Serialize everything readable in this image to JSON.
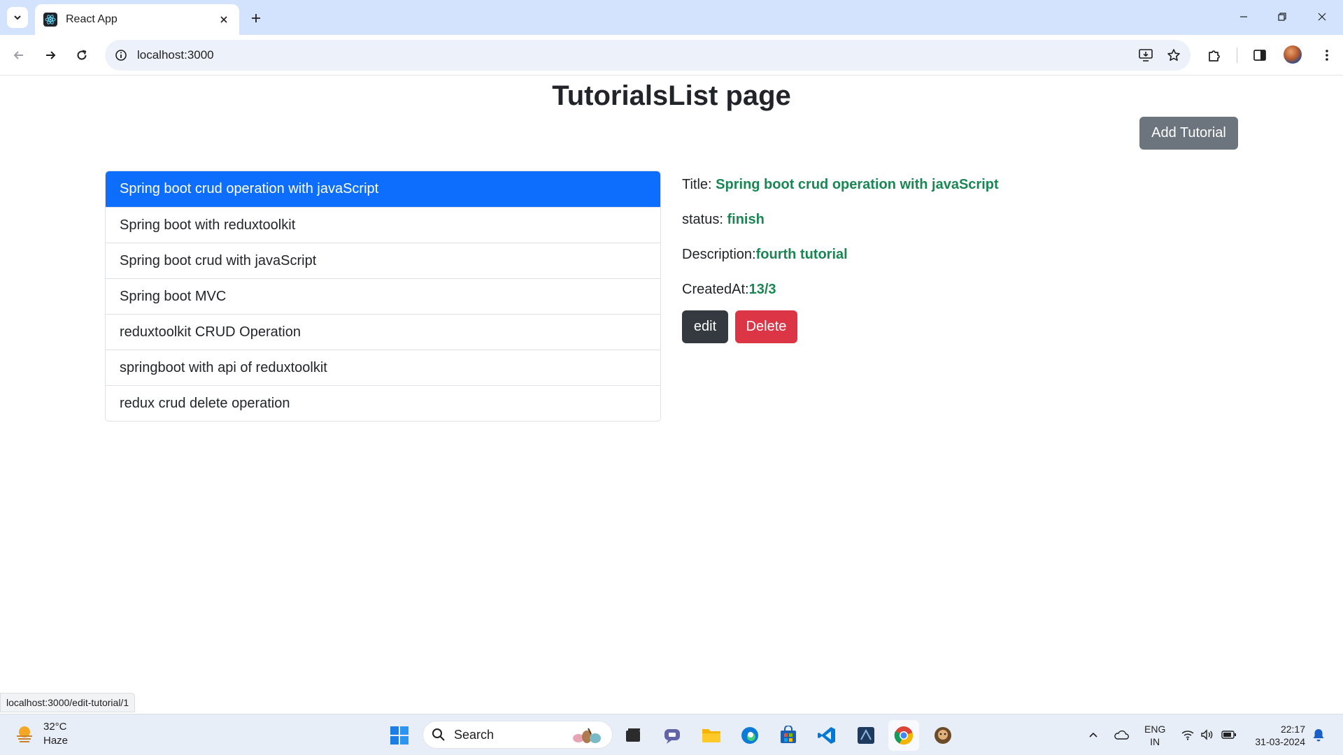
{
  "browser": {
    "tab_title": "React App",
    "url": "localhost:3000"
  },
  "page": {
    "title": "TutorialsList page",
    "add_button": "Add Tutorial",
    "tutorials": [
      "Spring boot crud operation with javaScript",
      "Spring boot with reduxtoolkit",
      "Spring boot crud with javaScript",
      "Spring boot MVC",
      "reduxtoolkit CRUD Operation",
      "springboot with api of reduxtoolkit",
      "redux crud delete operation"
    ],
    "selected_index": 0,
    "details": {
      "title_label": "Title:",
      "title_value": "Spring boot crud operation with javaScript",
      "status_label": "status:",
      "status_value": "finish",
      "description_label": "Description:",
      "description_value": "fourth tutorial",
      "created_label": "CreatedAt:",
      "created_value": "13/3"
    },
    "edit_button": "edit",
    "delete_button": "Delete"
  },
  "status_bar_link": "localhost:3000/edit-tutorial/1",
  "taskbar": {
    "temperature": "32°C",
    "weather": "Haze",
    "search_placeholder": "Search",
    "lang_top": "ENG",
    "lang_bottom": "IN",
    "time": "22:17",
    "date": "31-03-2024"
  },
  "colors": {
    "active_item": "#0d6efd",
    "value_text": "#198754",
    "delete_button": "#dc3545",
    "edit_button": "#343a40",
    "add_button": "#6c757d"
  }
}
